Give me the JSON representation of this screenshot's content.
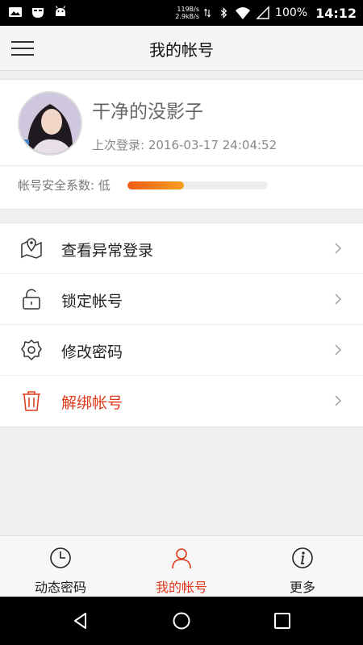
{
  "status_bar": {
    "speed_up": "119B/s",
    "speed_down": "2.9kB/s",
    "battery": "100%",
    "time": "14:12",
    "icons": [
      "image-icon",
      "mask-icon",
      "android-icon",
      "transfer-icon",
      "bluetooth-icon",
      "wifi-icon",
      "signal-icon",
      "battery-icon"
    ]
  },
  "header": {
    "title": "我的帐号",
    "menu_icon": "hamburger-icon"
  },
  "profile": {
    "username": "干净的没影子",
    "last_login": "上次登录: 2016-03-17 24:04:52",
    "security_label": "帐号安全系数: 低",
    "security_level": 0.4,
    "security_colors": [
      "#f05a14",
      "#f5a020"
    ]
  },
  "menu": {
    "items": [
      {
        "label": "查看异常登录",
        "icon": "map-pin-icon"
      },
      {
        "label": "锁定帐号",
        "icon": "lock-icon"
      },
      {
        "label": "修改密码",
        "icon": "settings-gear-icon"
      },
      {
        "label": "解绑帐号",
        "icon": "trash-icon",
        "color": "#e0391d"
      }
    ]
  },
  "tabs": {
    "items": [
      {
        "label": "动态密码",
        "icon": "clock-icon"
      },
      {
        "label": "我的帐号",
        "icon": "user-icon",
        "active": true,
        "color": "#e0391d"
      },
      {
        "label": "更多",
        "icon": "info-icon"
      }
    ]
  },
  "navbar": {
    "icons": [
      "back-icon",
      "home-icon",
      "recents-icon"
    ]
  }
}
